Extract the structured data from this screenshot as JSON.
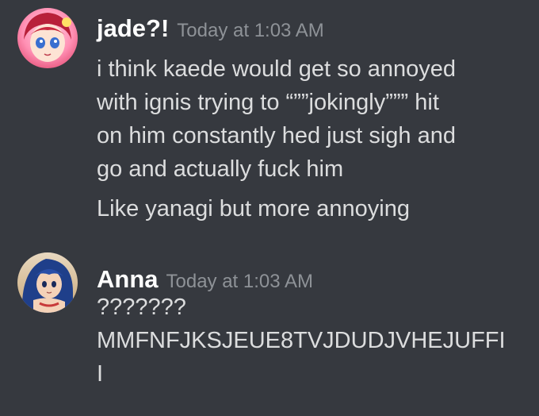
{
  "messages": [
    {
      "username": "jade?!",
      "timestamp": "Today at 1:03 AM",
      "lines": [
        "i think kaede would get so annoyed",
        "with ignis trying to “””jokingly””” hit",
        "on him constantly hed just sigh and",
        "go and actually fuck him"
      ],
      "followup": "Like yanagi but more annoying"
    },
    {
      "username": "Anna",
      "timestamp": "Today at 1:03 AM",
      "lines": [
        "???????",
        "MMFNFJKSJEUE8TVJDUDJVHEJUFFI",
        "I"
      ]
    }
  ]
}
